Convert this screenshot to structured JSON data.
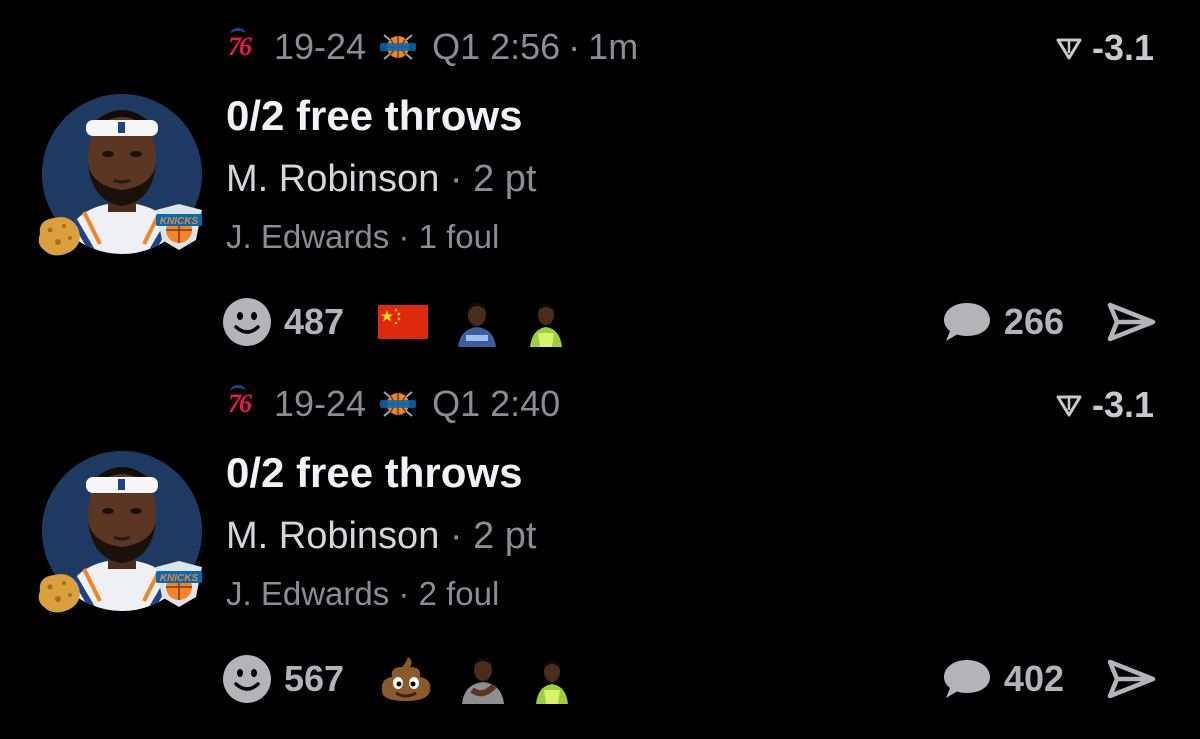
{
  "posts": [
    {
      "home_team_logo": "sixers-76-logo",
      "record": "19-24",
      "away_team_logo": "knicks-logo",
      "clock": "Q1 2:56",
      "age": "1m",
      "odds": "-3.1",
      "headline": "0/2 free throws",
      "player": "M. Robinson",
      "player_stat": "2 pt",
      "defender": "J. Edwards",
      "defender_stat": "1 foul",
      "reaction_count": "487",
      "reactions": [
        "china-flag",
        "player-photo-1",
        "player-photo-2"
      ],
      "comment_count": "266"
    },
    {
      "home_team_logo": "sixers-76-logo",
      "record": "19-24",
      "away_team_logo": "knicks-logo",
      "clock": "Q1 2:40",
      "age": "",
      "odds": "-3.1",
      "headline": "0/2 free throws",
      "player": "M. Robinson",
      "player_stat": "2 pt",
      "defender": "J. Edwards",
      "defender_stat": "2 foul",
      "reaction_count": "567",
      "reactions": [
        "poop-emoji",
        "player-photo-3",
        "player-photo-2"
      ],
      "comment_count": "402"
    }
  ],
  "separators": {
    "dot": "·"
  },
  "colors": {
    "background": "#000000",
    "primary_text": "#f2f2f4",
    "secondary_text": "#8c8c91",
    "icon_gray": "#b4b4b8",
    "sixers_red": "#ed174c",
    "sixers_blue": "#1d428a",
    "knicks_orange": "#f58426",
    "knicks_blue": "#006bb6"
  }
}
